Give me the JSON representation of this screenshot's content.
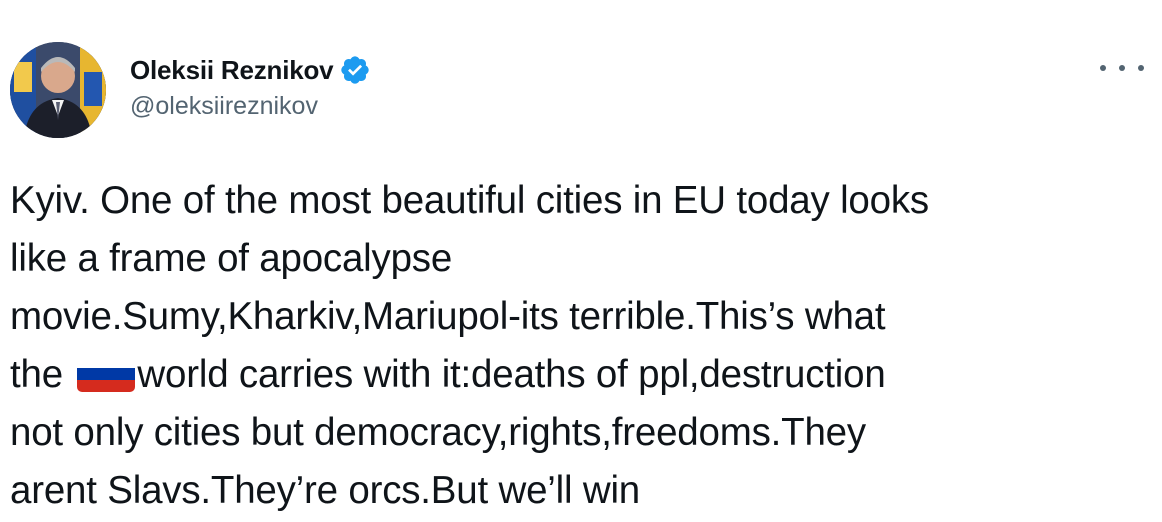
{
  "author": {
    "display_name": "Oleksii Reznikov",
    "handle": "@oleksiireznikov",
    "verified": true,
    "verified_color": "#1d9bf0"
  },
  "tweet": {
    "lines": [
      "Kyiv. One of the most beautiful cities in EU today looks",
      "like a frame of apocalypse",
      "movie.Sumy,Kharkiv,Mariupol-its terrible.This’s what",
      "not only cities but democracy,rights,freedoms.They",
      "arent Slavs.They’re orcs.But we’ll win"
    ],
    "line4_prefix": "the ",
    "line4_suffix": "world carries with it:deaths of ppl,destruction",
    "inline_icon": "russian-flag-emoji",
    "flag_colors": [
      "#ffffff",
      "#0039a6",
      "#d52b1e"
    ]
  },
  "more_icon": "more-options-icon",
  "colors": {
    "text": "#0f1419",
    "secondary": "#536471",
    "accent": "#1d9bf0"
  }
}
